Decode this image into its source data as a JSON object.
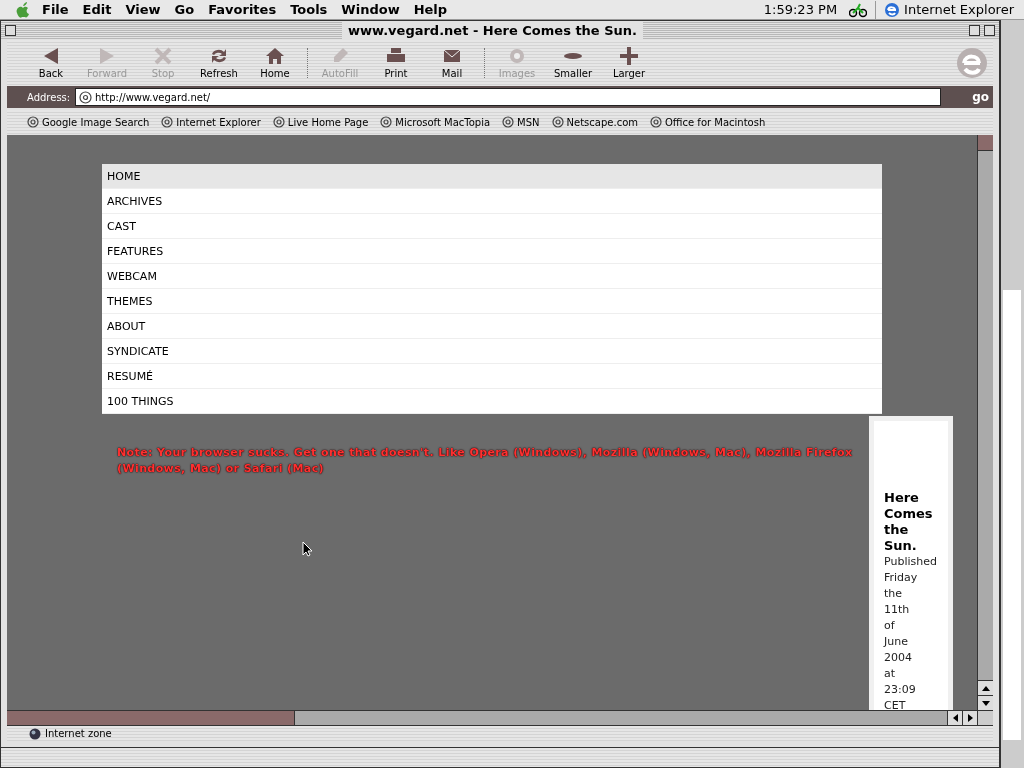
{
  "menu_bar": {
    "items": [
      "File",
      "Edit",
      "View",
      "Go",
      "Favorites",
      "Tools",
      "Window",
      "Help"
    ],
    "clock": "1:59:23 PM",
    "app_name": "Internet Explorer"
  },
  "window": {
    "title": "www.vegard.net - Here Comes the Sun."
  },
  "toolbar": {
    "buttons": [
      {
        "label": "Back",
        "kind": "back",
        "disabled": false
      },
      {
        "label": "Forward",
        "kind": "forward",
        "disabled": true
      },
      {
        "label": "Stop",
        "kind": "stop",
        "disabled": true
      },
      {
        "label": "Refresh",
        "kind": "refresh",
        "disabled": false
      },
      {
        "label": "Home",
        "kind": "home",
        "disabled": false
      },
      {
        "label": "AutoFill",
        "kind": "autofill",
        "disabled": true
      },
      {
        "label": "Print",
        "kind": "print",
        "disabled": false
      },
      {
        "label": "Mail",
        "kind": "mail",
        "disabled": false
      },
      {
        "label": "Images",
        "kind": "images",
        "disabled": true
      },
      {
        "label": "Smaller",
        "kind": "smaller",
        "disabled": false
      },
      {
        "label": "Larger",
        "kind": "larger",
        "disabled": false
      }
    ]
  },
  "address_bar": {
    "label": "Address:",
    "value": "http://www.vegard.net/",
    "go": "go"
  },
  "favorites_bar": [
    "Google Image Search",
    "Internet Explorer",
    "Live Home Page",
    "Microsoft MacTopia",
    "MSN",
    "Netscape.com",
    "Office for Macintosh"
  ],
  "page": {
    "nav": [
      {
        "label": "HOME",
        "selected": true
      },
      {
        "label": "ARCHIVES",
        "selected": false
      },
      {
        "label": "CAST",
        "selected": false
      },
      {
        "label": "FEATURES",
        "selected": false
      },
      {
        "label": "WEBCAM",
        "selected": false
      },
      {
        "label": "THEMES",
        "selected": false
      },
      {
        "label": "ABOUT",
        "selected": false
      },
      {
        "label": "SYNDICATE",
        "selected": false
      },
      {
        "label": "RESUMÉ",
        "selected": false
      },
      {
        "label": "100 THINGS",
        "selected": false
      }
    ],
    "note": "Note: Your browser sucks. Get one that doesn't. Like Opera (Windows), Mozilla (Windows, Mac), Mozilla Firefox (Windows, Mac) or Safari (Mac)",
    "post_title": "Here Comes the Sun.",
    "post_meta": "Published Friday the 11th of June 2004 at 23:09 CET"
  },
  "status_bar": {
    "zone": "Internet zone"
  }
}
